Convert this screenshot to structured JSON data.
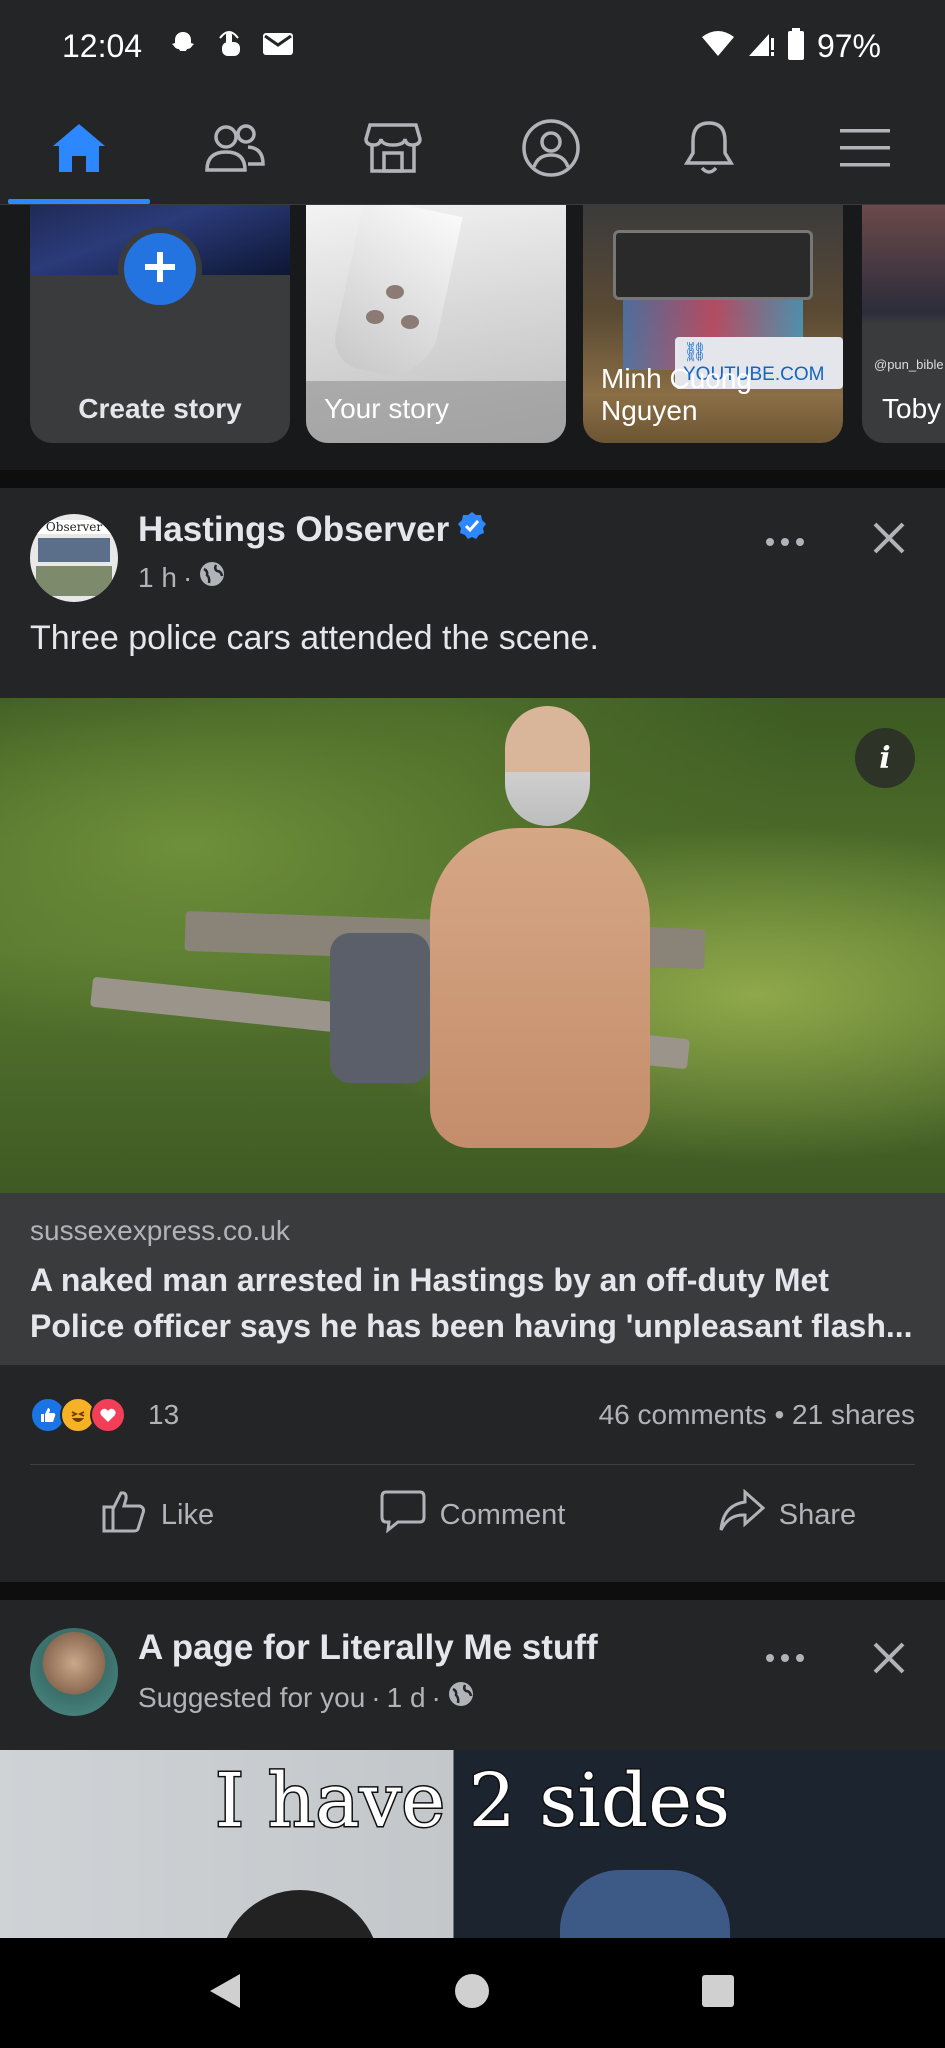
{
  "status_bar": {
    "time": "12:04",
    "battery": "97%",
    "icons": [
      "snapchat-icon",
      "touch-icon",
      "mail-icon",
      "wifi-icon",
      "signal-icon",
      "battery-icon"
    ]
  },
  "nav": {
    "items": [
      {
        "name": "home",
        "icon": "home-icon",
        "active": true
      },
      {
        "name": "friends",
        "icon": "friends-icon"
      },
      {
        "name": "marketplace",
        "icon": "marketplace-icon"
      },
      {
        "name": "profile",
        "icon": "profile-icon"
      },
      {
        "name": "notifications",
        "icon": "bell-icon"
      },
      {
        "name": "menu",
        "icon": "hamburger-menu-icon"
      }
    ],
    "accent": "#2d88ff"
  },
  "stories": [
    {
      "label": "Create story"
    },
    {
      "label": "Your story"
    },
    {
      "label_line1": "Minh Cuong",
      "label_line2": "Nguyen",
      "link": "YOUTUBE.COM"
    },
    {
      "label": "Toby",
      "handle": "@pun_bible"
    }
  ],
  "post1": {
    "author": "Hastings Observer",
    "verified": true,
    "time": "1 h",
    "privacy": "globe-icon",
    "text": "Three police cars attended the scene.",
    "link_domain": "sussexexpress.co.uk",
    "link_title": "A naked man arrested in Hastings by an off-duty Met Police officer says he has been having 'unpleasant flash...",
    "reaction_count": "13",
    "comments": "46 comments",
    "shares": "21 shares",
    "actions": {
      "like": "Like",
      "comment": "Comment",
      "share": "Share"
    }
  },
  "post2": {
    "author": "A page for Literally Me stuff",
    "meta_prefix": "Suggested for you",
    "time": "1 d",
    "meme_text": "I have 2 sides"
  }
}
